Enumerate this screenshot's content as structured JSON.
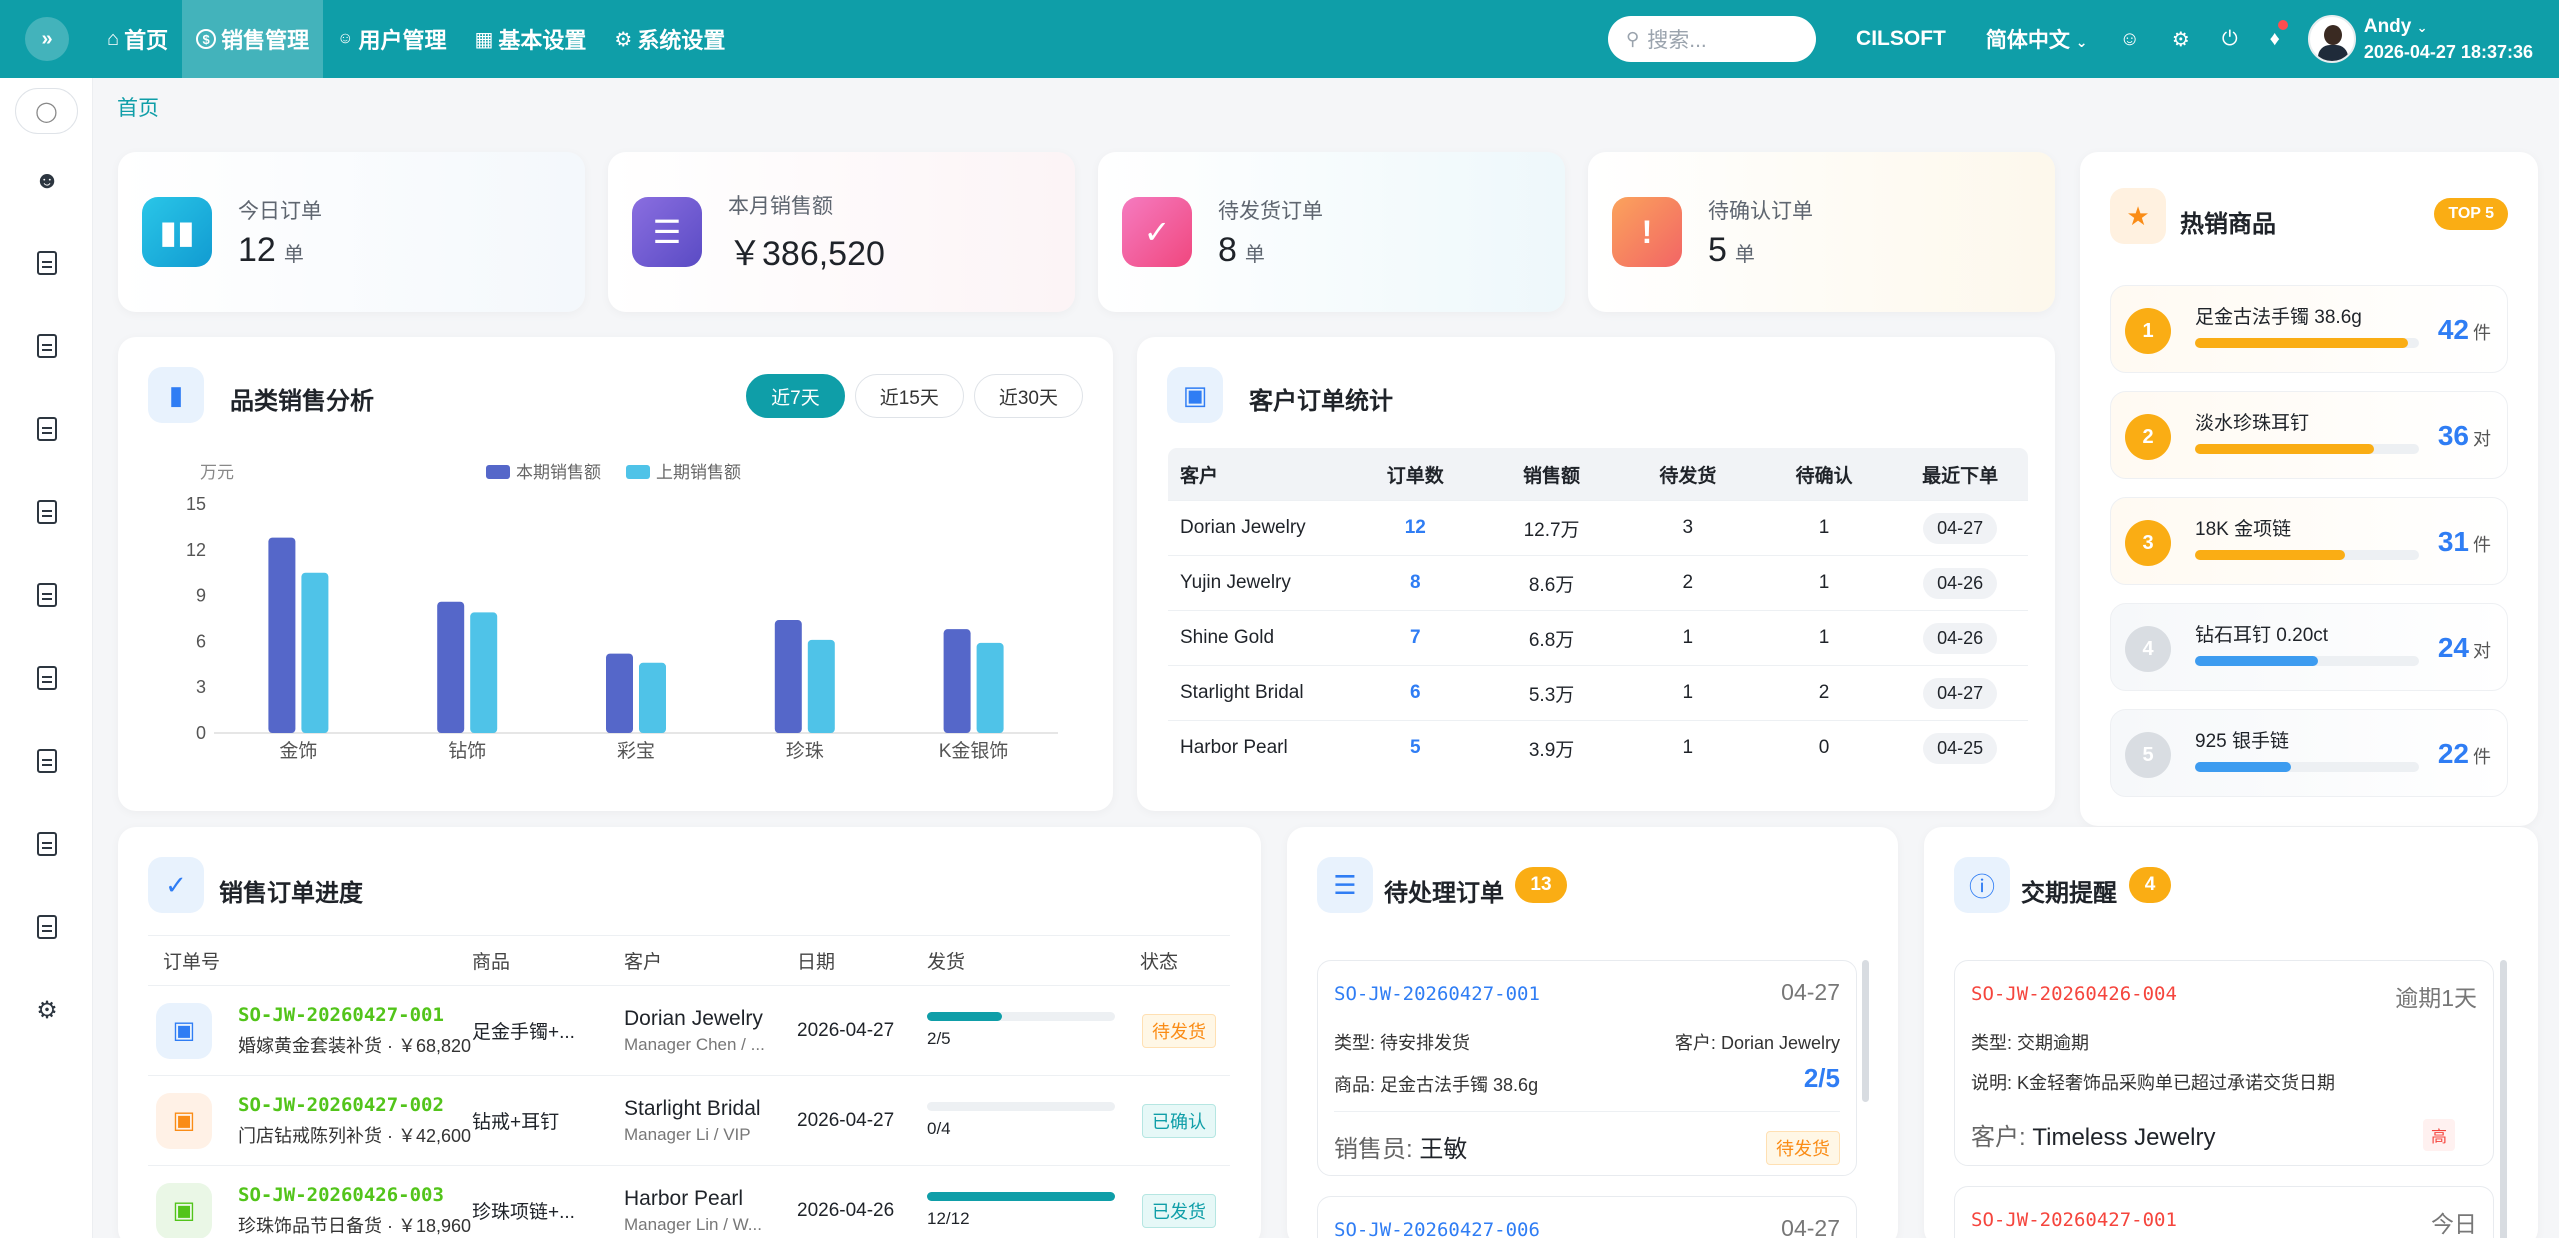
{
  "topbar": {
    "nav": [
      {
        "icon": "home-icon",
        "glyph": "⌂",
        "label": "首页"
      },
      {
        "icon": "dollar-icon",
        "glyph": "$",
        "label": "销售管理"
      },
      {
        "icon": "user-icon",
        "glyph": "👤",
        "label": "用户管理"
      },
      {
        "icon": "grid-icon",
        "glyph": "▦",
        "label": "基本设置"
      },
      {
        "icon": "gear-icon",
        "glyph": "⚙",
        "label": "系统设置"
      }
    ],
    "search_placeholder": "搜索...",
    "brand": "CILSOFT",
    "language": "简体中文",
    "user_name": "Andy",
    "datetime": "2026-04-27 18:37:36"
  },
  "breadcrumb": "首页",
  "stats": [
    {
      "label": "今日订单",
      "value": "12",
      "unit": "单",
      "icon": "bar-chart-icon",
      "color": "#1cb5e0"
    },
    {
      "label": "本月销售额",
      "value": "￥386,520",
      "unit": "",
      "icon": "document-icon",
      "color": "#6b5bd6"
    },
    {
      "label": "待发货订单",
      "value": "8",
      "unit": "单",
      "icon": "checklist-icon",
      "color": "#f45fa0"
    },
    {
      "label": "待确认订单",
      "value": "5",
      "unit": "单",
      "icon": "alert-icon",
      "color": "#f7893b"
    }
  ],
  "category_sales": {
    "title": "品类销售分析",
    "ranges": [
      "近7天",
      "近15天",
      "近30天"
    ],
    "active_range": "近7天"
  },
  "chart_data": {
    "type": "bar",
    "title": "",
    "ylabel": "万元",
    "xlabel": "",
    "categories": [
      "金饰",
      "钻饰",
      "彩宝",
      "珍珠",
      "K金银饰"
    ],
    "ylim": [
      0,
      15
    ],
    "yticks": [
      0,
      3,
      6,
      9,
      12,
      15
    ],
    "series": [
      {
        "name": "本期销售额",
        "color": "#5567c9",
        "values": [
          12.8,
          8.6,
          5.2,
          7.4,
          6.8
        ]
      },
      {
        "name": "上期销售额",
        "color": "#4fc3e8",
        "values": [
          10.5,
          7.9,
          4.6,
          6.1,
          5.9
        ]
      }
    ],
    "legend": "top-center",
    "grid": false
  },
  "customer_stats": {
    "title": "客户订单统计",
    "columns": [
      "客户",
      "订单数",
      "销售额",
      "待发货",
      "待确认",
      "最近下单"
    ],
    "rows": [
      [
        "Dorian Jewelry",
        "12",
        "12.7万",
        "3",
        "1",
        "04-27"
      ],
      [
        "Yujin Jewelry",
        "8",
        "8.6万",
        "2",
        "1",
        "04-26"
      ],
      [
        "Shine Gold",
        "7",
        "6.8万",
        "1",
        "1",
        "04-26"
      ],
      [
        "Starlight Bridal",
        "6",
        "5.3万",
        "1",
        "2",
        "04-27"
      ],
      [
        "Harbor Pearl",
        "5",
        "3.9万",
        "1",
        "0",
        "04-25"
      ]
    ]
  },
  "hot_products": {
    "title": "热销商品",
    "badge": "TOP 5",
    "items": [
      {
        "rank": "1",
        "name": "足金古法手镯 38.6g",
        "count": "42",
        "unit": "件",
        "progress": 0.95,
        "active": true
      },
      {
        "rank": "2",
        "name": "淡水珍珠耳钉",
        "count": "36",
        "unit": "对",
        "progress": 0.8,
        "active": true
      },
      {
        "rank": "3",
        "name": "18K 金项链",
        "count": "31",
        "unit": "件",
        "progress": 0.67,
        "active": true
      },
      {
        "rank": "4",
        "name": "钻石耳钉 0.20ct",
        "count": "24",
        "unit": "对",
        "progress": 0.55,
        "active": false
      },
      {
        "rank": "5",
        "name": "925 银手链",
        "count": "22",
        "unit": "件",
        "progress": 0.43,
        "active": false
      }
    ]
  },
  "order_progress": {
    "title": "销售订单进度",
    "columns": [
      "订单号",
      "商品",
      "客户",
      "日期",
      "发货",
      "状态"
    ],
    "rows": [
      {
        "icon": "chip-icon",
        "icon_bg": "#e8f2fd",
        "icon_color": "#2f7df4",
        "code": "SO-JW-20260427-001",
        "desc": "婚嫁黄金套装补货 · ￥68,820",
        "product": "足金手镯+...",
        "customer": "Dorian Jewelry",
        "contact": "Manager Chen / ...",
        "date": "2026-04-27",
        "shipped": "2/5",
        "progress": 0.4,
        "status": "待发货",
        "status_type": "pending"
      },
      {
        "icon": "photo-icon",
        "icon_bg": "#fff1e6",
        "icon_color": "#fa8c16",
        "code": "SO-JW-20260427-002",
        "desc": "门店钻戒陈列补货 · ￥42,600",
        "product": "钻戒+耳钉",
        "customer": "Starlight Bridal",
        "contact": "Manager Li / VIP",
        "date": "2026-04-27",
        "shipped": "0/4",
        "progress": 0,
        "status": "已确认",
        "status_type": "confirmed"
      },
      {
        "icon": "link-icon",
        "icon_bg": "#eaf7e6",
        "icon_color": "#52c41a",
        "code": "SO-JW-20260426-003",
        "desc": "珍珠饰品节日备货 · ￥18,960",
        "product": "珍珠项链+...",
        "customer": "Harbor Pearl",
        "contact": "Manager Lin / W...",
        "date": "2026-04-26",
        "shipped": "12/12",
        "progress": 1,
        "status": "已发货",
        "status_type": "confirmed"
      }
    ]
  },
  "pending_orders": {
    "title": "待处理订单",
    "count": "13",
    "items": [
      {
        "code": "SO-JW-20260427-001",
        "date": "04-27",
        "type_label": "类型:",
        "type": "待安排发货",
        "customer_label": "客户:",
        "customer": "Dorian Jewelry",
        "product_label": "商品:",
        "product": "足金古法手镯 38.6g",
        "progress": "2/5",
        "sales_label": "销售员:",
        "sales": "王敏",
        "status": "待发货"
      },
      {
        "code": "SO-JW-20260427-006",
        "date": "04-27"
      }
    ]
  },
  "delivery_alerts": {
    "title": "交期提醒",
    "count": "4",
    "items": [
      {
        "code": "SO-JW-20260426-004",
        "due": "逾期1天",
        "type_label": "类型:",
        "type": "交期逾期",
        "note_label": "说明:",
        "note": "K金轻奢饰品采购单已超过承诺交货日期",
        "customer_label": "客户:",
        "customer": "Timeless Jewelry",
        "level": "高"
      },
      {
        "code": "SO-JW-20260427-001",
        "due": "今日"
      }
    ]
  }
}
